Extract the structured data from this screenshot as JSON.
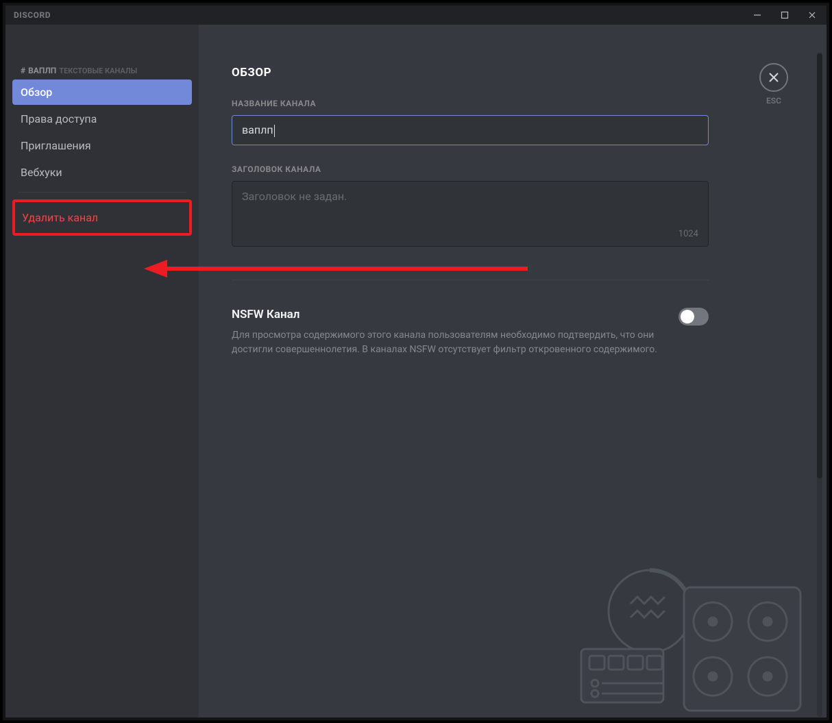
{
  "app": {
    "name": "DISCORD"
  },
  "close": {
    "esc_label": "ESC"
  },
  "sidebar": {
    "hash": "#",
    "channel_name": "ВАПЛП",
    "channel_type": "ТЕКСТОВЫЕ КАНАЛЫ",
    "items": [
      {
        "label": "Обзор"
      },
      {
        "label": "Права доступа"
      },
      {
        "label": "Приглашения"
      },
      {
        "label": "Вебхуки"
      }
    ],
    "delete_label": "Удалить канал"
  },
  "main": {
    "title": "ОБЗОР",
    "name_label": "НАЗВАНИЕ КАНАЛА",
    "name_value": "ваплп",
    "topic_label": "ЗАГОЛОВОК КАНАЛА",
    "topic_placeholder": "Заголовок не задан.",
    "topic_counter": "1024",
    "nsfw_title": "NSFW Канал",
    "nsfw_desc": "Для просмотра содержимого этого канала пользователям необходимо подтвердить, что они достигли совершеннолетия. В каналах NSFW отсутствует фильтр откровенного содержимого."
  }
}
